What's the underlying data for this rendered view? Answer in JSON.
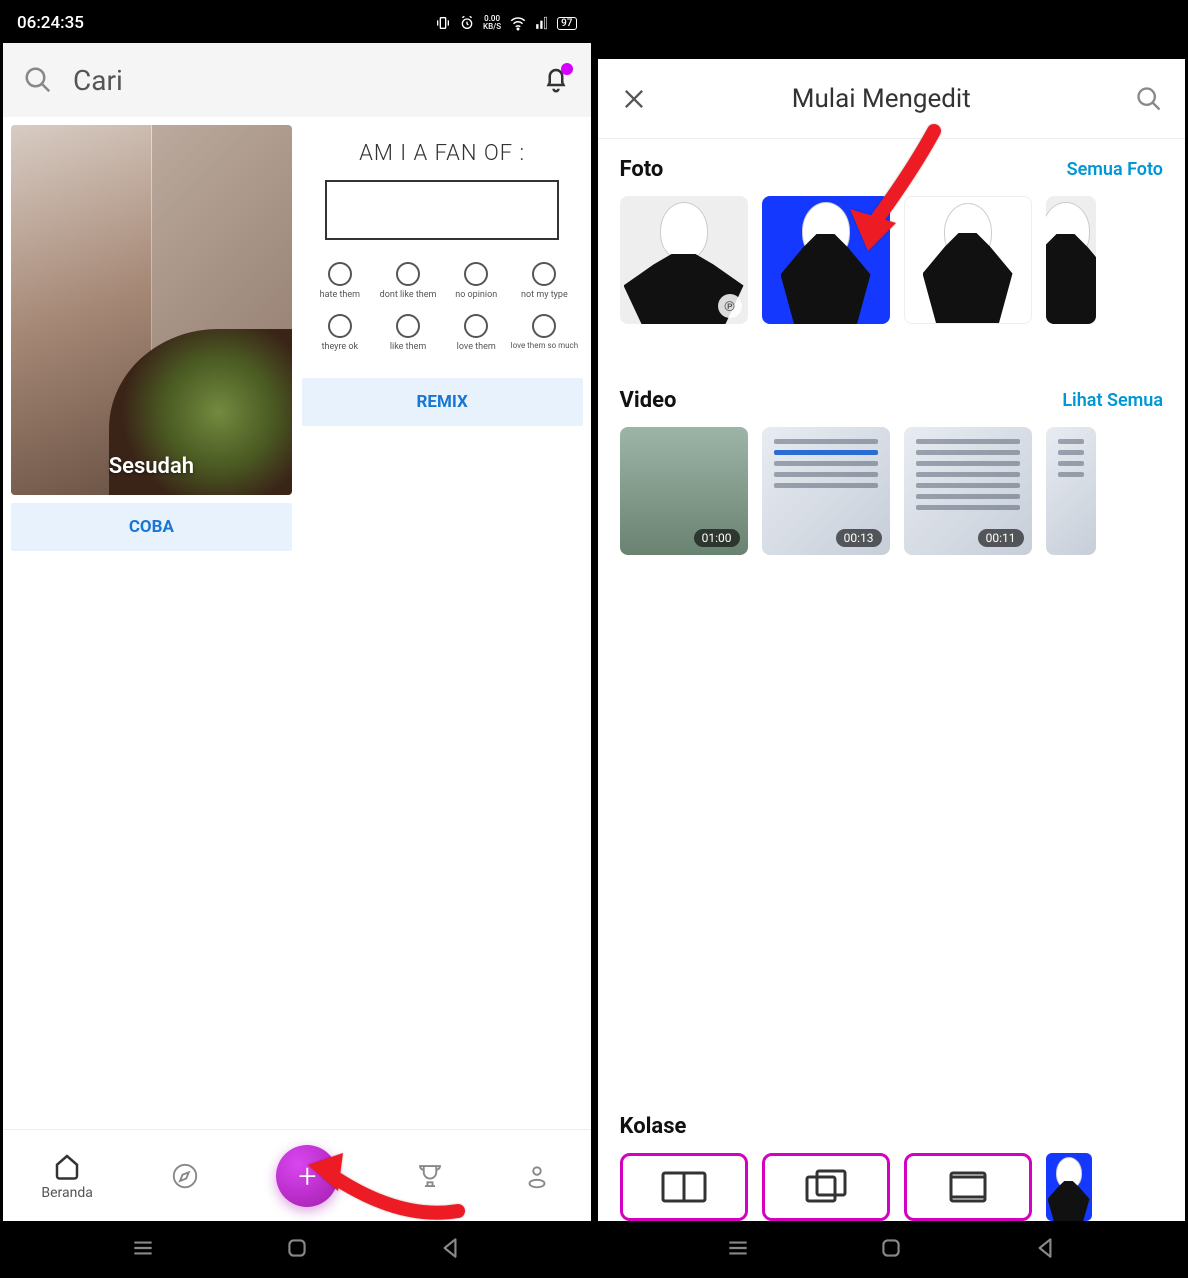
{
  "left": {
    "status": {
      "time": "06:24:35",
      "kbps_val": "0.00",
      "kbps_unit": "KB/S",
      "battery": "97"
    },
    "search_placeholder": "Cari",
    "card_left": {
      "caption": "Sesudah",
      "button": "COBA"
    },
    "card_right": {
      "title": "AM I A FAN OF :",
      "row1": [
        "hate them",
        "dont like them",
        "no opinion",
        "not my type"
      ],
      "row2": [
        "theyre ok",
        "like them",
        "love them",
        "love them\nso much"
      ],
      "button": "REMIX"
    },
    "nav": {
      "home": "Beranda"
    }
  },
  "right": {
    "title": "Mulai Mengedit",
    "foto": {
      "title": "Foto",
      "link": "Semua Foto"
    },
    "video": {
      "title": "Video",
      "link": "Lihat Semua",
      "durations": [
        "01:00",
        "00:13",
        "00:11"
      ]
    },
    "kolase": {
      "title": "Kolase"
    }
  }
}
